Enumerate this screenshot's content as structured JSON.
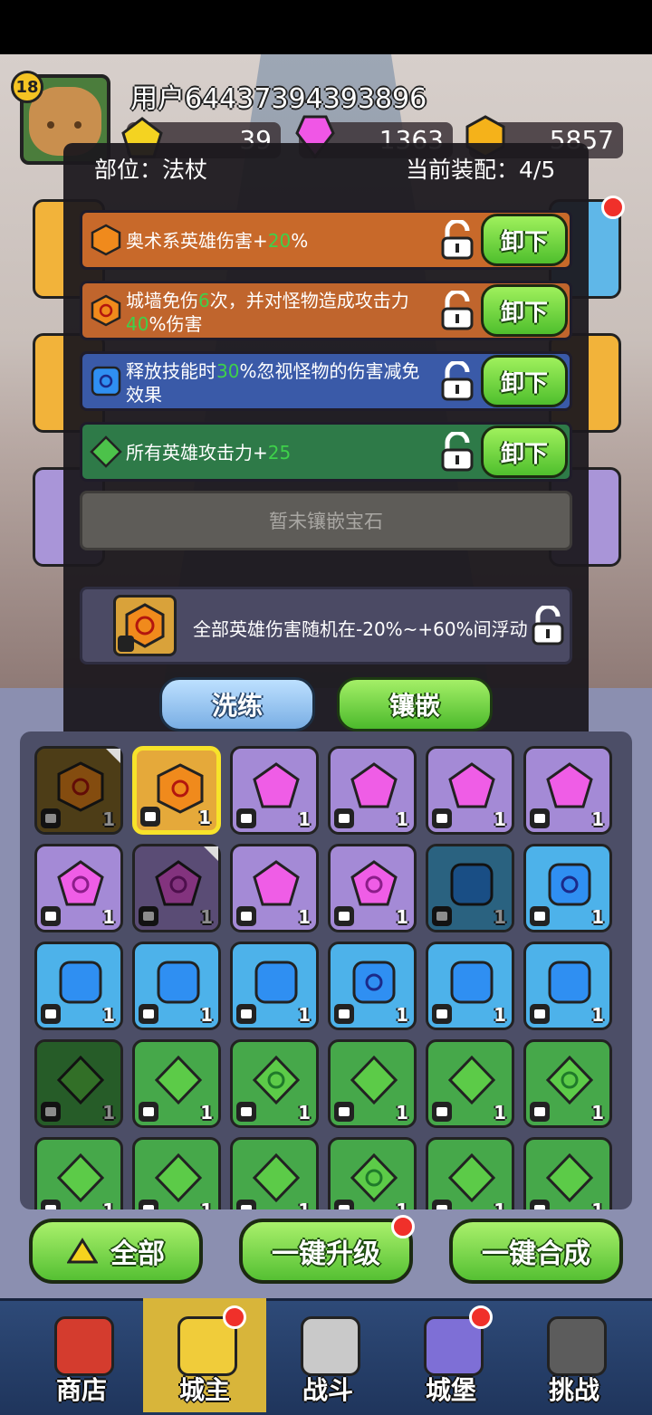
{
  "header": {
    "level": "18",
    "username": "用户64437394393896",
    "currencies": [
      {
        "icon": "gold-gem-icon",
        "value": "39"
      },
      {
        "icon": "pink-crystal-icon",
        "value": "1363"
      },
      {
        "icon": "gold-coin-icon",
        "value": "5857"
      }
    ]
  },
  "modal": {
    "slot_label": "部位：法杖",
    "equip_label": "当前装配：4/5",
    "gems": [
      {
        "color": "#c8692a",
        "icon": "orange-hexagon-gem-icon",
        "parts": [
          {
            "t": "奥术系英雄伤害+"
          },
          {
            "t": "20",
            "g": true
          },
          {
            "t": "%"
          }
        ],
        "unload": "卸下"
      },
      {
        "color": "#c0652d",
        "icon": "orange-swirl-gem-icon",
        "parts": [
          {
            "t": "城墙免伤"
          },
          {
            "t": "6",
            "g": true
          },
          {
            "t": "次，并对怪物造成攻击力"
          },
          {
            "t": "40",
            "g": true
          },
          {
            "t": "%伤害"
          }
        ],
        "unload": "卸下"
      },
      {
        "color": "#3a5aa8",
        "icon": "blue-swirl-gem-icon",
        "parts": [
          {
            "t": "释放技能时"
          },
          {
            "t": "30",
            "g": true
          },
          {
            "t": "%忽视怪物的伤害减免效果"
          }
        ],
        "unload": "卸下"
      },
      {
        "color": "#2e7a48",
        "icon": "green-diamond-gem-icon",
        "parts": [
          {
            "t": "所有英雄攻击力+"
          },
          {
            "t": "25",
            "g": true
          }
        ],
        "unload": "卸下"
      }
    ],
    "empty_slot": "暂未镶嵌宝石",
    "main_stone_text": "全部英雄伤害随机在-20%~+60%间浮动",
    "wash_button": "洗练",
    "inlay_button": "镶嵌"
  },
  "inventory": [
    {
      "color": "orange",
      "count": "1",
      "part": "boot",
      "dim": true,
      "corner": true
    },
    {
      "color": "orange",
      "count": "1",
      "part": "staff",
      "selected": true
    },
    {
      "color": "purple",
      "count": "1",
      "part": "crown"
    },
    {
      "color": "purple",
      "count": "1",
      "part": "armor"
    },
    {
      "color": "purple",
      "count": "1",
      "part": "armor"
    },
    {
      "color": "purple",
      "count": "1",
      "part": "boot"
    },
    {
      "color": "purple",
      "count": "1",
      "part": "staff",
      "swirl": true
    },
    {
      "color": "purple",
      "count": "1",
      "part": "ring",
      "dim": true,
      "corner": true,
      "swirl": true
    },
    {
      "color": "purple",
      "count": "1",
      "part": "shield"
    },
    {
      "color": "purple",
      "count": "1",
      "part": "shield",
      "swirl": true
    },
    {
      "color": "blue",
      "count": "1",
      "part": "crown",
      "dim": true
    },
    {
      "color": "blue",
      "count": "1",
      "part": "crown",
      "swirl": true
    },
    {
      "color": "blue",
      "count": "1",
      "part": "armor"
    },
    {
      "color": "blue",
      "count": "1",
      "part": "armor"
    },
    {
      "color": "blue",
      "count": "1",
      "part": "armor"
    },
    {
      "color": "blue",
      "count": "1",
      "part": "boot",
      "swirl": true
    },
    {
      "color": "blue",
      "count": "1",
      "part": "boot"
    },
    {
      "color": "blue",
      "count": "1",
      "part": "shield"
    },
    {
      "color": "green",
      "count": "1",
      "part": "crown",
      "dim": true
    },
    {
      "color": "green",
      "count": "1",
      "part": "crown"
    },
    {
      "color": "green",
      "count": "1",
      "part": "crown",
      "swirl": true
    },
    {
      "color": "green",
      "count": "1",
      "part": "crown"
    },
    {
      "color": "green",
      "count": "1",
      "part": "armor"
    },
    {
      "color": "green",
      "count": "1",
      "part": "armor",
      "swirl": true
    },
    {
      "color": "green",
      "count": "1",
      "part": "armor"
    },
    {
      "color": "green",
      "count": "1",
      "part": "armor"
    },
    {
      "color": "green",
      "count": "1",
      "part": "boot"
    },
    {
      "color": "green",
      "count": "1",
      "part": "staff",
      "swirl": true
    },
    {
      "color": "green",
      "count": "1",
      "part": "armor"
    },
    {
      "color": "green",
      "count": "1",
      "part": "boot"
    }
  ],
  "actions": {
    "all_label": "全部",
    "upgrade_label": "一键升级",
    "merge_label": "一键合成"
  },
  "nav": [
    {
      "label": "商店",
      "icon": "shop-icon"
    },
    {
      "label": "城主",
      "icon": "crown-icon",
      "active": true,
      "dot": true
    },
    {
      "label": "战斗",
      "icon": "crossed-swords-icon"
    },
    {
      "label": "城堡",
      "icon": "castle-icon",
      "dot": true
    },
    {
      "label": "挑战",
      "icon": "demon-icon"
    }
  ]
}
